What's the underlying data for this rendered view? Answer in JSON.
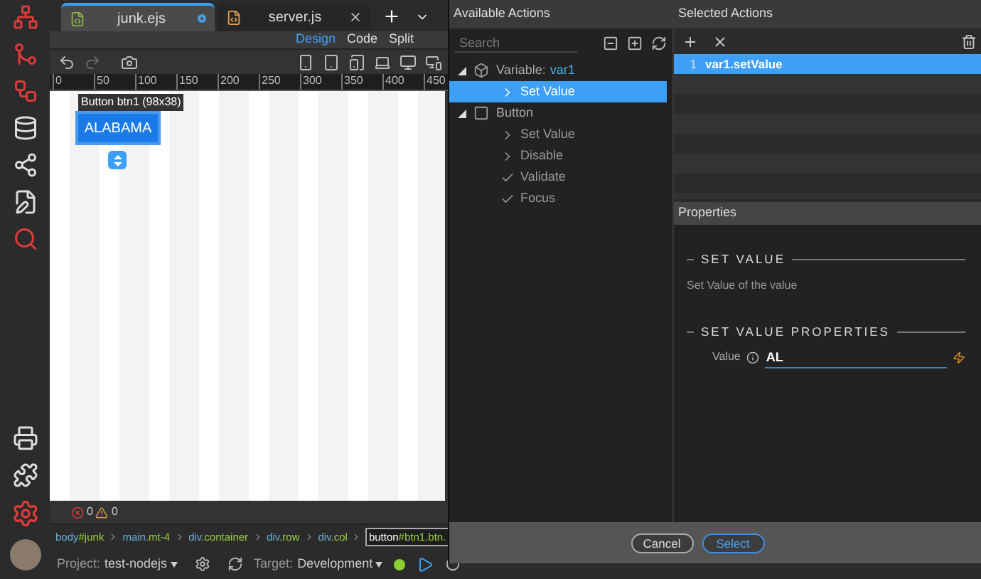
{
  "editor_tabs": [
    {
      "label": "junk.ejs",
      "selected": true,
      "modified": true
    },
    {
      "label": "server.js",
      "selected": false,
      "modified": false
    }
  ],
  "view_modes": [
    {
      "label": "Design",
      "selected": true
    },
    {
      "label": "Code",
      "selected": false
    },
    {
      "label": "Split",
      "selected": false
    }
  ],
  "ruler": [
    "0",
    "50",
    "100",
    "150",
    "200",
    "250",
    "300",
    "350",
    "400",
    "450"
  ],
  "canvas": {
    "tooltip": "Button btn1 (98x38)",
    "button_label": "ALABAMA"
  },
  "problems": {
    "errors": "0",
    "warnings": "0"
  },
  "breadcrumb": [
    {
      "element": "body",
      "qualifier": "#junk",
      "selected": false
    },
    {
      "element": "main",
      "qualifier": ".mt-4",
      "selected": false
    },
    {
      "element": "div",
      "qualifier": ".container",
      "selected": false
    },
    {
      "element": "div",
      "qualifier": ".row",
      "selected": false
    },
    {
      "element": "div",
      "qualifier": ".col",
      "selected": false
    },
    {
      "element": "button",
      "qualifier": "#btn1.btn.",
      "selected": true
    }
  ],
  "status_bar": {
    "project_label": "Project:",
    "project": "test-nodejs",
    "target_label": "Target:",
    "target": "Development"
  },
  "dialog": {
    "available": {
      "title": "Available Actions",
      "search": {
        "placeholder": "Search"
      },
      "tree": [
        {
          "label": "Variable:",
          "name": "var1",
          "kind": "variable",
          "expanded": true,
          "children": [
            {
              "label": "Set Value",
              "kind": "action",
              "selected": true
            }
          ]
        },
        {
          "label": "Button",
          "kind": "button",
          "expanded": true,
          "children": [
            {
              "label": "Set Value",
              "kind": "action",
              "selected": false
            },
            {
              "label": "Disable",
              "kind": "action",
              "selected": false
            },
            {
              "label": "Validate",
              "kind": "check",
              "selected": false
            },
            {
              "label": "Focus",
              "kind": "check",
              "selected": false
            }
          ]
        }
      ]
    },
    "selected": {
      "title": "Selected Actions",
      "rows": [
        {
          "number": "1",
          "action": "var1.setValue",
          "selected": true
        }
      ]
    },
    "properties": {
      "title": "Properties",
      "section": "SET VALUE",
      "description": "Set Value of the value",
      "subsection": "SET VALUE PROPERTIES",
      "field": {
        "label": "Value",
        "value": "AL"
      }
    },
    "buttons": [
      {
        "label": "Cancel",
        "kind": "secondary"
      },
      {
        "label": "Select",
        "kind": "primary"
      }
    ]
  }
}
